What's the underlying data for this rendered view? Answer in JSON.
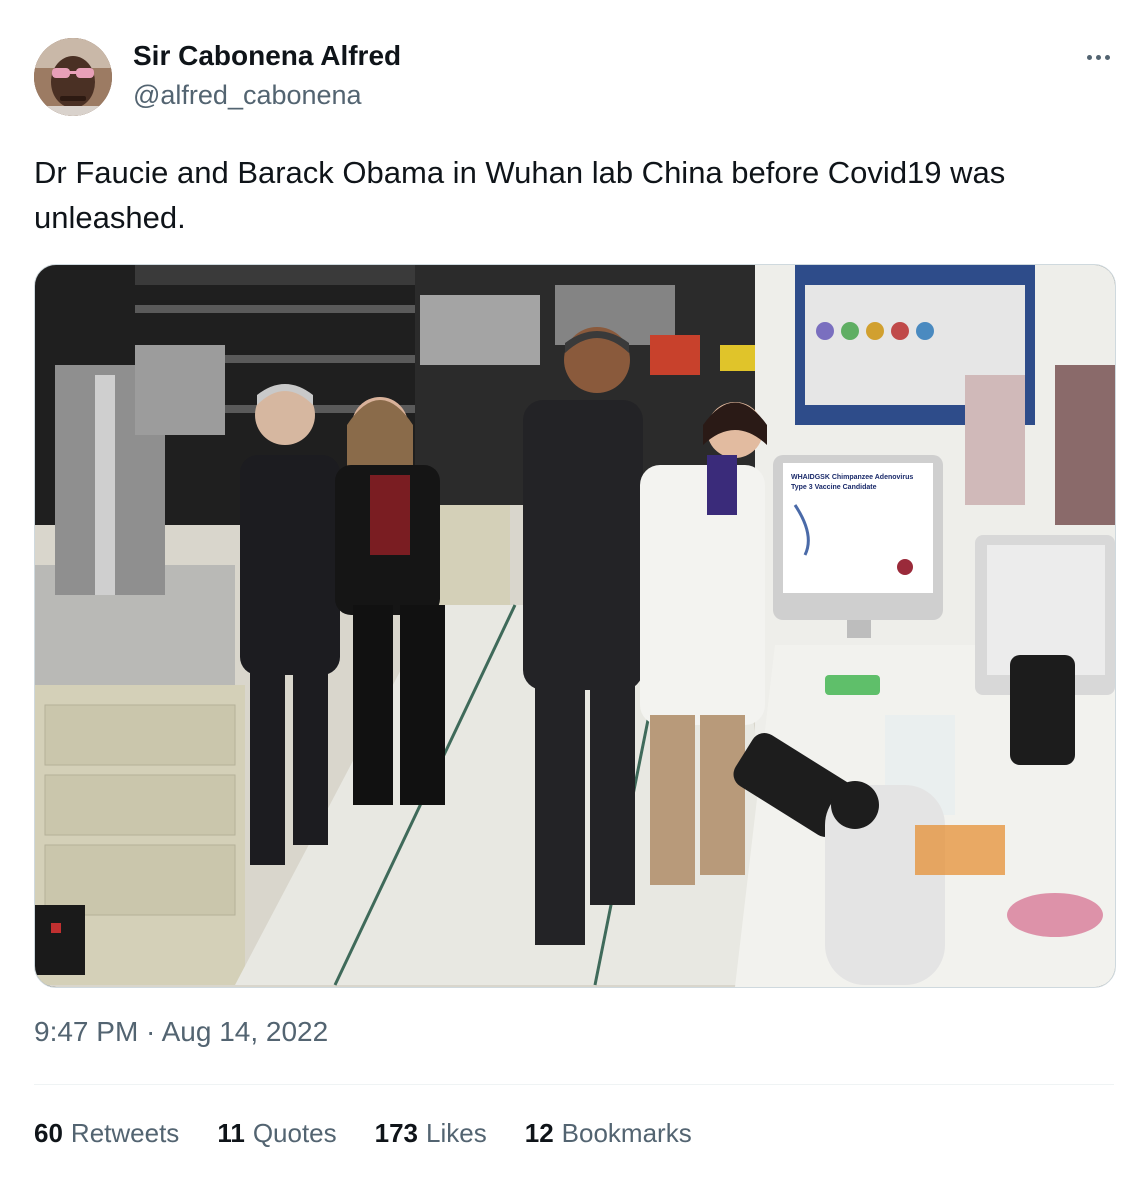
{
  "author": {
    "name": "Sir Cabonena Alfred",
    "handle": "@alfred_cabonena"
  },
  "tweet": {
    "text": "Dr Faucie and Barack Obama in Wuhan lab China before Covid19 was unleashed.",
    "timestamp": "9:47 PM · Aug 14, 2022"
  },
  "media": {
    "monitor_title_line1": "WHAIDGSK Chimpanzee Adenovirus",
    "monitor_title_line2": "Type 3 Vaccine Candidate"
  },
  "stats": [
    {
      "count": "60",
      "label": "Retweets"
    },
    {
      "count": "11",
      "label": "Quotes"
    },
    {
      "count": "173",
      "label": "Likes"
    },
    {
      "count": "12",
      "label": "Bookmarks"
    }
  ],
  "icons": {
    "more": "more-horizontal-icon"
  },
  "colors": {
    "text_primary": "#0f1419",
    "text_secondary": "#536471",
    "divider": "#eff3f4"
  }
}
